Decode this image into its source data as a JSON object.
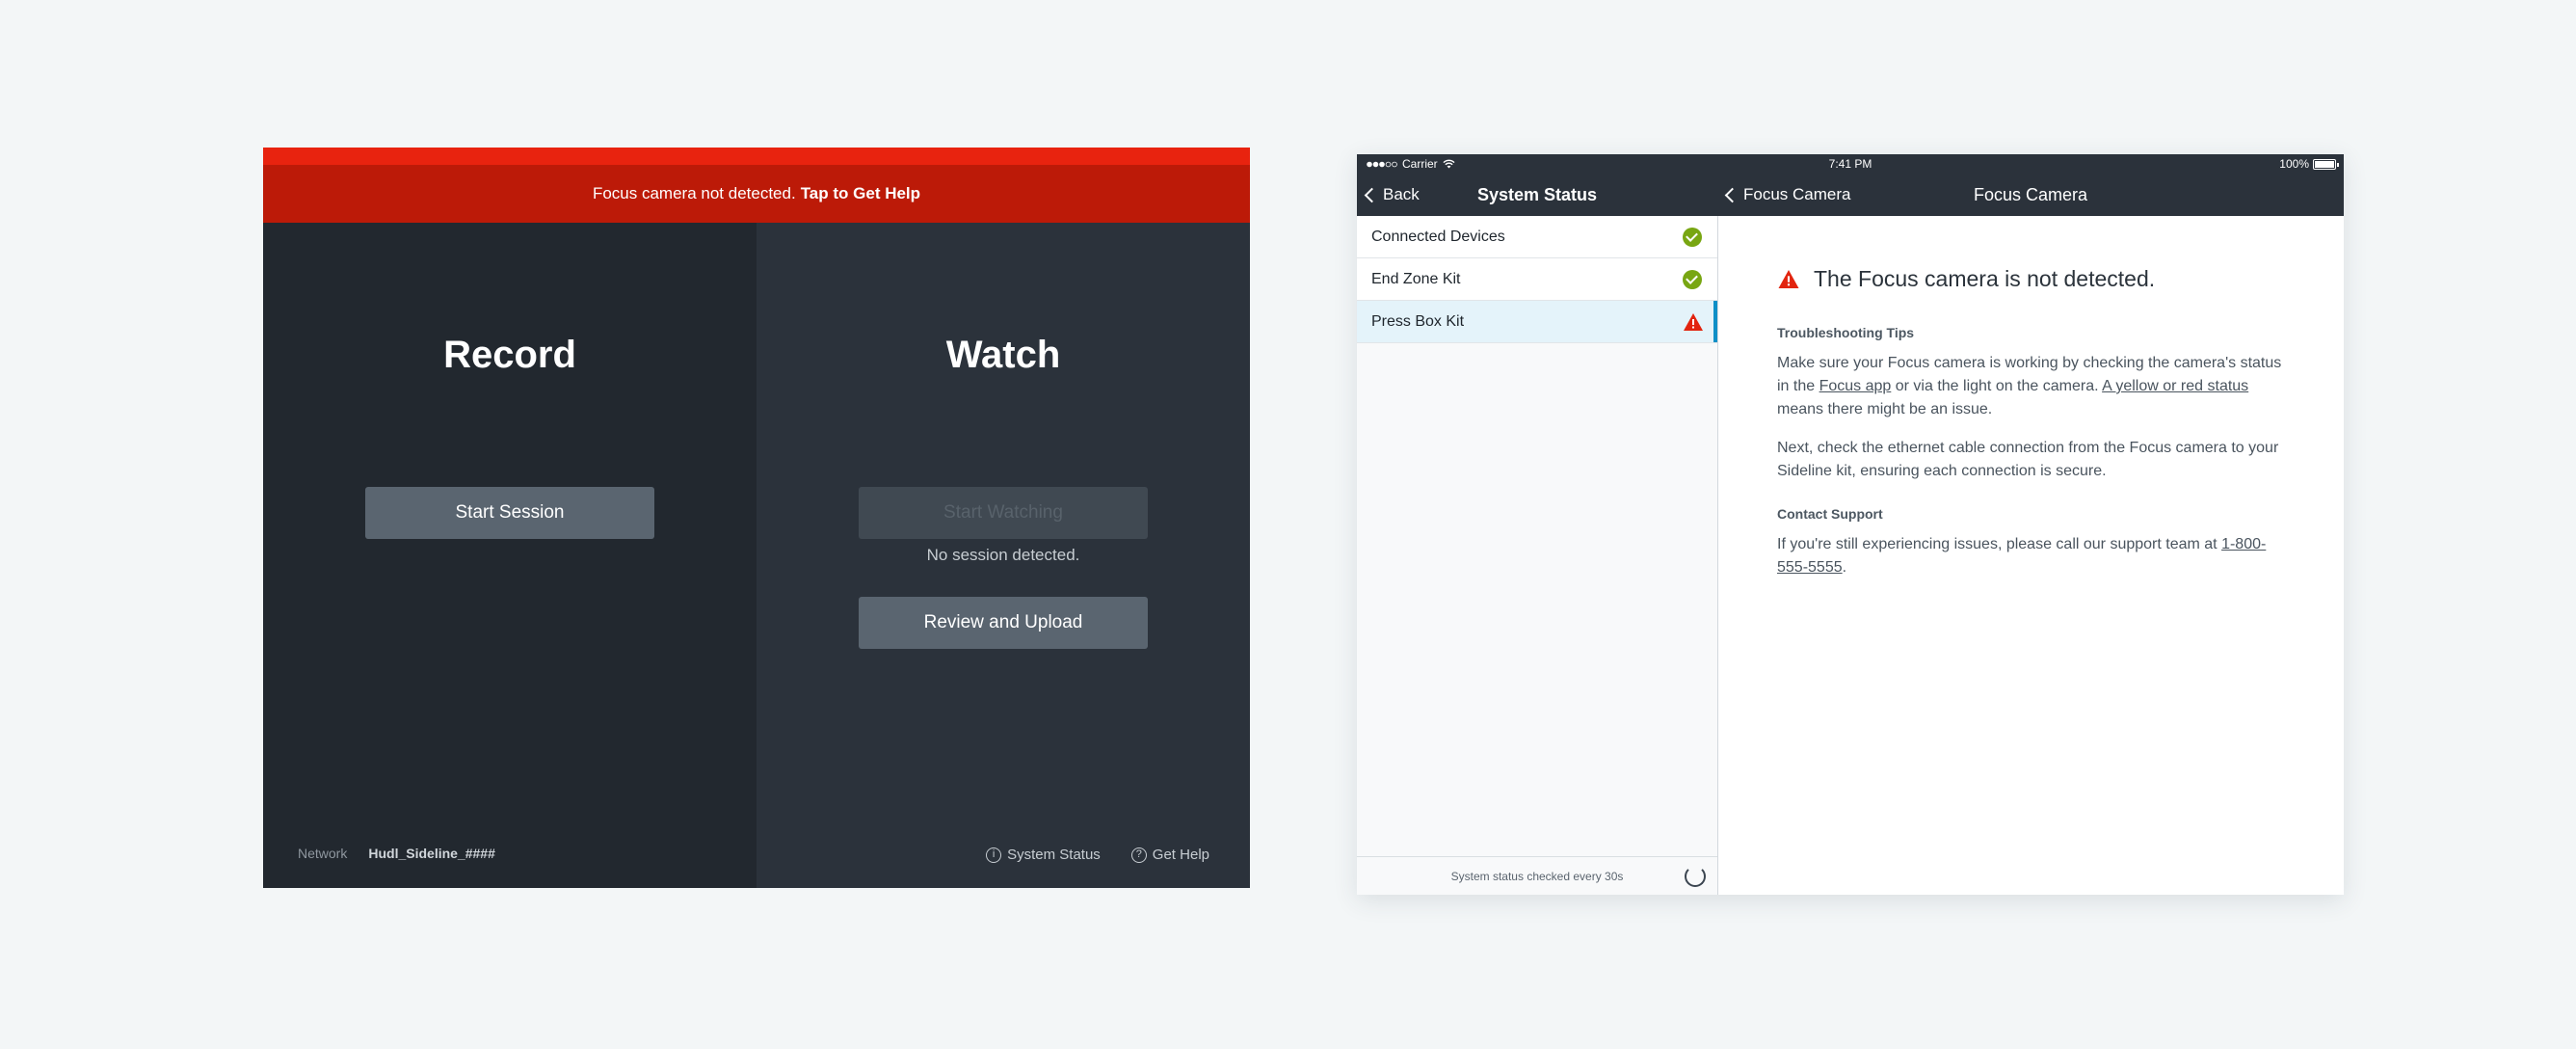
{
  "left": {
    "alert": {
      "text": "Focus camera not detected.",
      "action": "Tap to Get Help"
    },
    "record": {
      "title": "Record",
      "button": "Start Session"
    },
    "watch": {
      "title": "Watch",
      "start_button": "Start Watching",
      "note": "No session detected.",
      "review_button": "Review and Upload"
    },
    "footer": {
      "network_label": "Network",
      "network_value": "Hudl_Sideline_####",
      "system_status": "System Status",
      "get_help": "Get Help"
    }
  },
  "right": {
    "statusbar": {
      "carrier": "Carrier",
      "time": "7:41 PM",
      "battery": "100%"
    },
    "nav": {
      "back": "Back",
      "title": "System Status",
      "detail_back": "Focus Camera",
      "detail_title": "Focus Camera"
    },
    "list": [
      {
        "label": "Connected Devices",
        "status": "ok"
      },
      {
        "label": "End Zone Kit",
        "status": "ok"
      },
      {
        "label": "Press Box Kit",
        "status": "warning"
      }
    ],
    "sidebar_footer": "System status checked every 30s",
    "content": {
      "heading": "The Focus camera is not detected.",
      "tips_label": "Troubleshooting Tips",
      "p1_a": "Make sure your Focus camera is working by checking the camera's status in the ",
      "p1_link1": "Focus app",
      "p1_b": " or via the light on the camera. ",
      "p1_link2": "A yellow or red status",
      "p1_c": " means there might be an issue.",
      "p2": "Next, check the ethernet cable connection from the Focus camera to your Sideline kit, ensuring each connection is secure.",
      "support_label": "Contact Support",
      "p3": "If you're still experiencing issues, please call our support team at ",
      "phone": "1-800-555-5555",
      "p3_end": "."
    },
    "colors": {
      "ok": "#78a612",
      "warning": "#e2240f",
      "accent": "#0e8fc7",
      "alert": "#bc1a08"
    }
  }
}
